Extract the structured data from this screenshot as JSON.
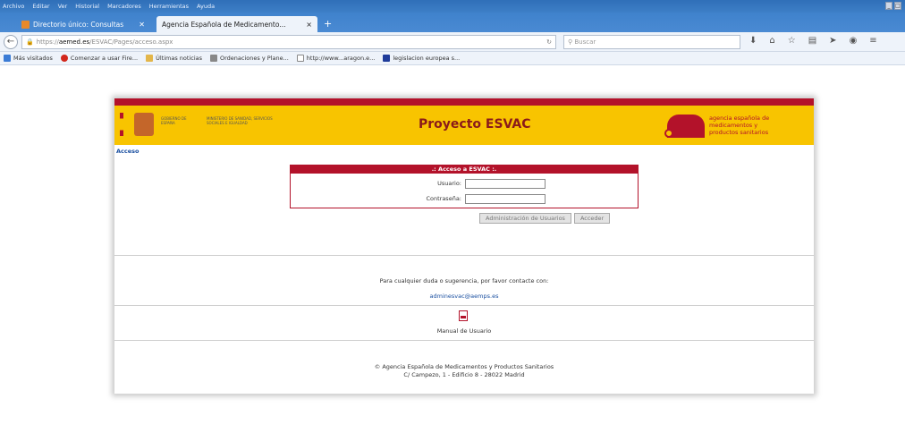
{
  "menu": [
    "Archivo",
    "Editar",
    "Ver",
    "Historial",
    "Marcadores",
    "Herramientas",
    "Ayuda"
  ],
  "tabs": [
    {
      "title": "Directorio único: Consultas"
    },
    {
      "title": "Agencia Española de Medicamento..."
    }
  ],
  "url": {
    "prefix": "https://",
    "host": "aemed.es",
    "path": "/ESVAC/Pages/acceso.aspx"
  },
  "search_placeholder": "Buscar",
  "bookmarks": [
    "Más visitados",
    "Comenzar a usar Fire...",
    "Últimas noticias",
    "Ordenaciones y Plane...",
    "http://www...aragon.e...",
    "legislacion europea s..."
  ],
  "banner": {
    "gov_text": "GOBIERNO DE ESPAÑA",
    "ministry_text": "MINISTERIO DE SANIDAD, SERVICIOS SOCIALES E IGUALDAD",
    "title": "Proyecto ESVAC",
    "agency_line1": "agencia española de",
    "agency_line2": "medicamentos y",
    "agency_line3": "productos sanitarios"
  },
  "breadcrumb": "Acceso",
  "login": {
    "header": ".: Acceso a ESVAC :.",
    "user_label": "Usuario:",
    "password_label": "Contraseña:",
    "admin_button": "Administración de Usuarios",
    "submit_button": "Acceder"
  },
  "contact": {
    "text": "Para cualquier duda o sugerencia, por favor contacte con:",
    "email": "adminesvac@aemps.es"
  },
  "manual_link": "Manual de Usuario",
  "footer": {
    "line1": "© Agencia Española de Medicamentos y Productos Sanitarios",
    "line2": "C/ Campezo, 1 - Edificio 8 - 28022 Madrid"
  }
}
